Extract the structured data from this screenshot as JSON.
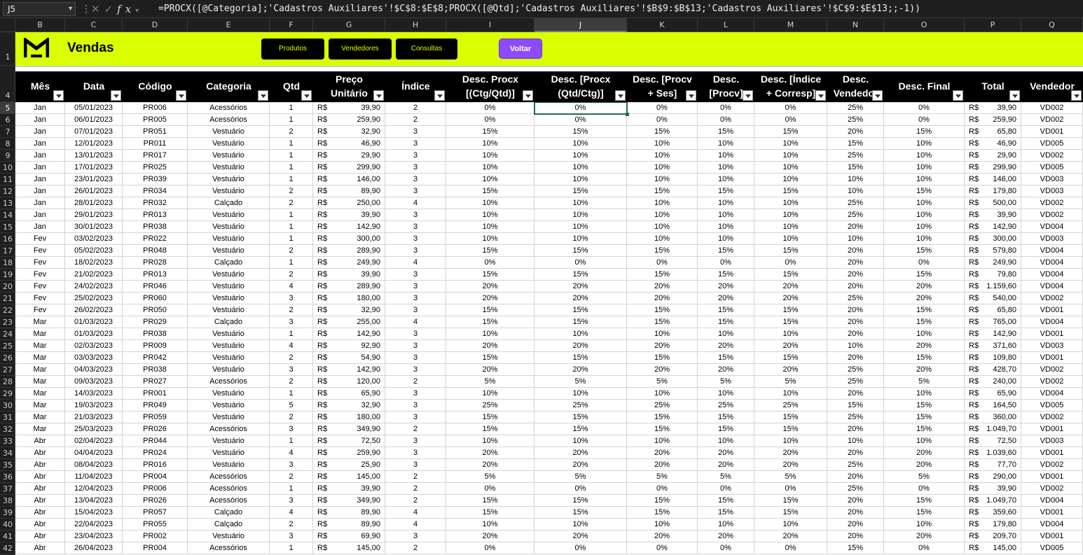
{
  "formula_bar": {
    "name_box": "J5",
    "formula": "=PROCX([@Categoria];'Cadastros Auxiliares'!$C$8:$E$8;PROCX([@Qtd];'Cadastros Auxiliares'!$B$9:$B$13;'Cadastros Auxiliares'!$C$9:$E$13;;-1))",
    "icon_cancel": "✕",
    "icon_enter": "✓",
    "icon_fx": "fx"
  },
  "column_letters": [
    "B",
    "C",
    "D",
    "E",
    "F",
    "G",
    "H",
    "I",
    "J",
    "K",
    "L",
    "M",
    "N",
    "O",
    "P",
    "Q"
  ],
  "selected_column": "J",
  "selected_row": "5",
  "row_numbers": [
    "1",
    "4",
    "5",
    "6",
    "7",
    "8",
    "9",
    "10",
    "11",
    "12",
    "13",
    "14",
    "15",
    "16",
    "17",
    "18",
    "19",
    "20",
    "21",
    "22",
    "23",
    "24",
    "25",
    "26",
    "27",
    "28",
    "29",
    "30",
    "31",
    "32",
    "33",
    "34",
    "35",
    "36",
    "37",
    "38",
    "39",
    "40",
    "41",
    "42"
  ],
  "banner": {
    "logo_glyph": "M",
    "title": "Vendas",
    "buttons": [
      "Produtos",
      "Vendedores",
      "Consultas"
    ],
    "back_button": "Voltar",
    "accent": "#d9ff00",
    "button_accent": "#8c4bff"
  },
  "table": {
    "headers": [
      "Mês",
      "Data",
      "Código",
      "Categoria",
      "Qtd",
      "Preço\nUnitário",
      "Índice",
      "Desc. Procx\n[(Ctg/Qtd)]",
      "Desc. [Procx\n(Qtd/Ctg)]",
      "Desc. [Procv\n+ Ses]",
      "Desc.\n[Procv]",
      "Desc. [Índice\n+ Corresp]",
      "Desc.\nVendedor",
      "Desc. Final",
      "Total",
      "Vendedor"
    ],
    "currency": "R$",
    "rows": [
      [
        "Jan",
        "05/01/2023",
        "PR006",
        "Acessórios",
        "1",
        "39,90",
        "2",
        "0%",
        "0%",
        "0%",
        "0%",
        "0%",
        "25%",
        "0%",
        "39,90",
        "VD002"
      ],
      [
        "Jan",
        "06/01/2023",
        "PR005",
        "Acessórios",
        "1",
        "259,90",
        "2",
        "0%",
        "0%",
        "0%",
        "0%",
        "0%",
        "25%",
        "0%",
        "259,90",
        "VD002"
      ],
      [
        "Jan",
        "07/01/2023",
        "PR051",
        "Vestuário",
        "2",
        "32,90",
        "3",
        "15%",
        "15%",
        "15%",
        "15%",
        "15%",
        "20%",
        "15%",
        "65,80",
        "VD001"
      ],
      [
        "Jan",
        "12/01/2023",
        "PR011",
        "Vestuário",
        "1",
        "46,90",
        "3",
        "10%",
        "10%",
        "10%",
        "10%",
        "10%",
        "15%",
        "10%",
        "46,90",
        "VD005"
      ],
      [
        "Jan",
        "13/01/2023",
        "PR017",
        "Vestuário",
        "1",
        "29,90",
        "3",
        "10%",
        "10%",
        "10%",
        "10%",
        "10%",
        "25%",
        "10%",
        "29,90",
        "VD002"
      ],
      [
        "Jan",
        "17/01/2023",
        "PR025",
        "Vestuário",
        "1",
        "299,90",
        "3",
        "10%",
        "10%",
        "10%",
        "10%",
        "10%",
        "15%",
        "10%",
        "299,90",
        "VD005"
      ],
      [
        "Jan",
        "23/01/2023",
        "PR039",
        "Vestuário",
        "1",
        "146,00",
        "3",
        "10%",
        "10%",
        "10%",
        "10%",
        "10%",
        "10%",
        "10%",
        "146,00",
        "VD003"
      ],
      [
        "Jan",
        "26/01/2023",
        "PR034",
        "Vestuário",
        "2",
        "89,90",
        "3",
        "15%",
        "15%",
        "15%",
        "15%",
        "15%",
        "10%",
        "15%",
        "179,80",
        "VD003"
      ],
      [
        "Jan",
        "28/01/2023",
        "PR032",
        "Calçado",
        "2",
        "250,00",
        "4",
        "10%",
        "10%",
        "10%",
        "10%",
        "10%",
        "25%",
        "10%",
        "500,00",
        "VD002"
      ],
      [
        "Jan",
        "29/01/2023",
        "PR013",
        "Vestuário",
        "1",
        "39,90",
        "3",
        "10%",
        "10%",
        "10%",
        "10%",
        "10%",
        "25%",
        "10%",
        "39,90",
        "VD002"
      ],
      [
        "Jan",
        "30/01/2023",
        "PR038",
        "Vestuário",
        "1",
        "142,90",
        "3",
        "10%",
        "10%",
        "10%",
        "10%",
        "10%",
        "20%",
        "10%",
        "142,90",
        "VD004"
      ],
      [
        "Fev",
        "03/02/2023",
        "PR022",
        "Vestuário",
        "1",
        "300,00",
        "3",
        "10%",
        "10%",
        "10%",
        "10%",
        "10%",
        "10%",
        "10%",
        "300,00",
        "VD003"
      ],
      [
        "Fev",
        "05/02/2023",
        "PR048",
        "Vestuário",
        "2",
        "289,90",
        "3",
        "15%",
        "15%",
        "15%",
        "15%",
        "15%",
        "20%",
        "15%",
        "579,80",
        "VD004"
      ],
      [
        "Fev",
        "18/02/2023",
        "PR028",
        "Calçado",
        "1",
        "249,90",
        "4",
        "0%",
        "0%",
        "0%",
        "0%",
        "0%",
        "20%",
        "0%",
        "249,90",
        "VD004"
      ],
      [
        "Fev",
        "21/02/2023",
        "PR013",
        "Vestuário",
        "2",
        "39,90",
        "3",
        "15%",
        "15%",
        "15%",
        "15%",
        "15%",
        "20%",
        "15%",
        "79,80",
        "VD004"
      ],
      [
        "Fev",
        "24/02/2023",
        "PR046",
        "Vestuário",
        "4",
        "289,90",
        "3",
        "20%",
        "20%",
        "20%",
        "20%",
        "20%",
        "20%",
        "20%",
        "1.159,60",
        "VD004"
      ],
      [
        "Fev",
        "25/02/2023",
        "PR060",
        "Vestuário",
        "3",
        "180,00",
        "3",
        "20%",
        "20%",
        "20%",
        "20%",
        "20%",
        "25%",
        "20%",
        "540,00",
        "VD002"
      ],
      [
        "Fev",
        "26/02/2023",
        "PR050",
        "Vestuário",
        "2",
        "32,90",
        "3",
        "15%",
        "15%",
        "15%",
        "15%",
        "15%",
        "20%",
        "15%",
        "65,80",
        "VD001"
      ],
      [
        "Mar",
        "01/03/2023",
        "PR029",
        "Calçado",
        "3",
        "255,00",
        "4",
        "15%",
        "15%",
        "15%",
        "15%",
        "15%",
        "20%",
        "15%",
        "765,00",
        "VD004"
      ],
      [
        "Mar",
        "01/03/2023",
        "PR038",
        "Vestuário",
        "1",
        "142,90",
        "3",
        "10%",
        "10%",
        "10%",
        "10%",
        "10%",
        "20%",
        "10%",
        "142,90",
        "VD001"
      ],
      [
        "Mar",
        "02/03/2023",
        "PR009",
        "Vestuário",
        "4",
        "92,90",
        "3",
        "20%",
        "20%",
        "20%",
        "20%",
        "20%",
        "10%",
        "20%",
        "371,60",
        "VD003"
      ],
      [
        "Mar",
        "03/03/2023",
        "PR042",
        "Vestuário",
        "2",
        "54,90",
        "3",
        "15%",
        "15%",
        "15%",
        "15%",
        "15%",
        "20%",
        "15%",
        "109,80",
        "VD001"
      ],
      [
        "Mar",
        "04/03/2023",
        "PR038",
        "Vestuário",
        "3",
        "142,90",
        "3",
        "20%",
        "20%",
        "20%",
        "20%",
        "20%",
        "25%",
        "20%",
        "428,70",
        "VD002"
      ],
      [
        "Mar",
        "09/03/2023",
        "PR027",
        "Acessórios",
        "2",
        "120,00",
        "2",
        "5%",
        "5%",
        "5%",
        "5%",
        "5%",
        "25%",
        "5%",
        "240,00",
        "VD002"
      ],
      [
        "Mar",
        "14/03/2023",
        "PR001",
        "Vestuário",
        "1",
        "65,90",
        "3",
        "10%",
        "10%",
        "10%",
        "10%",
        "10%",
        "20%",
        "10%",
        "65,90",
        "VD004"
      ],
      [
        "Mar",
        "19/03/2023",
        "PR049",
        "Vestuário",
        "5",
        "32,90",
        "3",
        "25%",
        "25%",
        "25%",
        "25%",
        "25%",
        "15%",
        "15%",
        "164,50",
        "VD005"
      ],
      [
        "Mar",
        "21/03/2023",
        "PR059",
        "Vestuário",
        "2",
        "180,00",
        "3",
        "15%",
        "15%",
        "15%",
        "15%",
        "15%",
        "25%",
        "15%",
        "360,00",
        "VD002"
      ],
      [
        "Mar",
        "25/03/2023",
        "PR026",
        "Acessórios",
        "3",
        "349,90",
        "2",
        "15%",
        "15%",
        "15%",
        "15%",
        "15%",
        "20%",
        "15%",
        "1.049,70",
        "VD001"
      ],
      [
        "Abr",
        "02/04/2023",
        "PR044",
        "Vestuário",
        "1",
        "72,50",
        "3",
        "10%",
        "10%",
        "10%",
        "10%",
        "10%",
        "10%",
        "10%",
        "72,50",
        "VD003"
      ],
      [
        "Abr",
        "04/04/2023",
        "PR024",
        "Vestuário",
        "4",
        "259,90",
        "3",
        "20%",
        "20%",
        "20%",
        "20%",
        "20%",
        "20%",
        "20%",
        "1.039,60",
        "VD001"
      ],
      [
        "Abr",
        "08/04/2023",
        "PR016",
        "Vestuário",
        "3",
        "25,90",
        "3",
        "20%",
        "20%",
        "20%",
        "20%",
        "20%",
        "25%",
        "20%",
        "77,70",
        "VD002"
      ],
      [
        "Abr",
        "11/04/2023",
        "PR004",
        "Acessórios",
        "2",
        "145,00",
        "2",
        "5%",
        "5%",
        "5%",
        "5%",
        "5%",
        "20%",
        "5%",
        "290,00",
        "VD001"
      ],
      [
        "Abr",
        "12/04/2023",
        "PR006",
        "Acessórios",
        "1",
        "39,90",
        "2",
        "0%",
        "0%",
        "0%",
        "0%",
        "0%",
        "25%",
        "0%",
        "39,90",
        "VD002"
      ],
      [
        "Abr",
        "13/04/2023",
        "PR026",
        "Acessórios",
        "3",
        "349,90",
        "2",
        "15%",
        "15%",
        "15%",
        "15%",
        "15%",
        "20%",
        "15%",
        "1.049,70",
        "VD004"
      ],
      [
        "Abr",
        "15/04/2023",
        "PR057",
        "Calçado",
        "4",
        "89,90",
        "4",
        "15%",
        "15%",
        "15%",
        "15%",
        "15%",
        "20%",
        "15%",
        "359,60",
        "VD001"
      ],
      [
        "Abr",
        "22/04/2023",
        "PR055",
        "Calçado",
        "2",
        "89,90",
        "4",
        "10%",
        "10%",
        "10%",
        "10%",
        "10%",
        "20%",
        "10%",
        "179,80",
        "VD004"
      ],
      [
        "Abr",
        "23/04/2023",
        "PR002",
        "Vestuário",
        "3",
        "69,90",
        "3",
        "20%",
        "20%",
        "20%",
        "20%",
        "20%",
        "20%",
        "20%",
        "209,70",
        "VD001"
      ],
      [
        "Abr",
        "26/04/2023",
        "PR004",
        "Acessórios",
        "1",
        "145,00",
        "2",
        "0%",
        "0%",
        "0%",
        "0%",
        "0%",
        "15%",
        "0%",
        "145,00",
        "VD005"
      ]
    ]
  }
}
